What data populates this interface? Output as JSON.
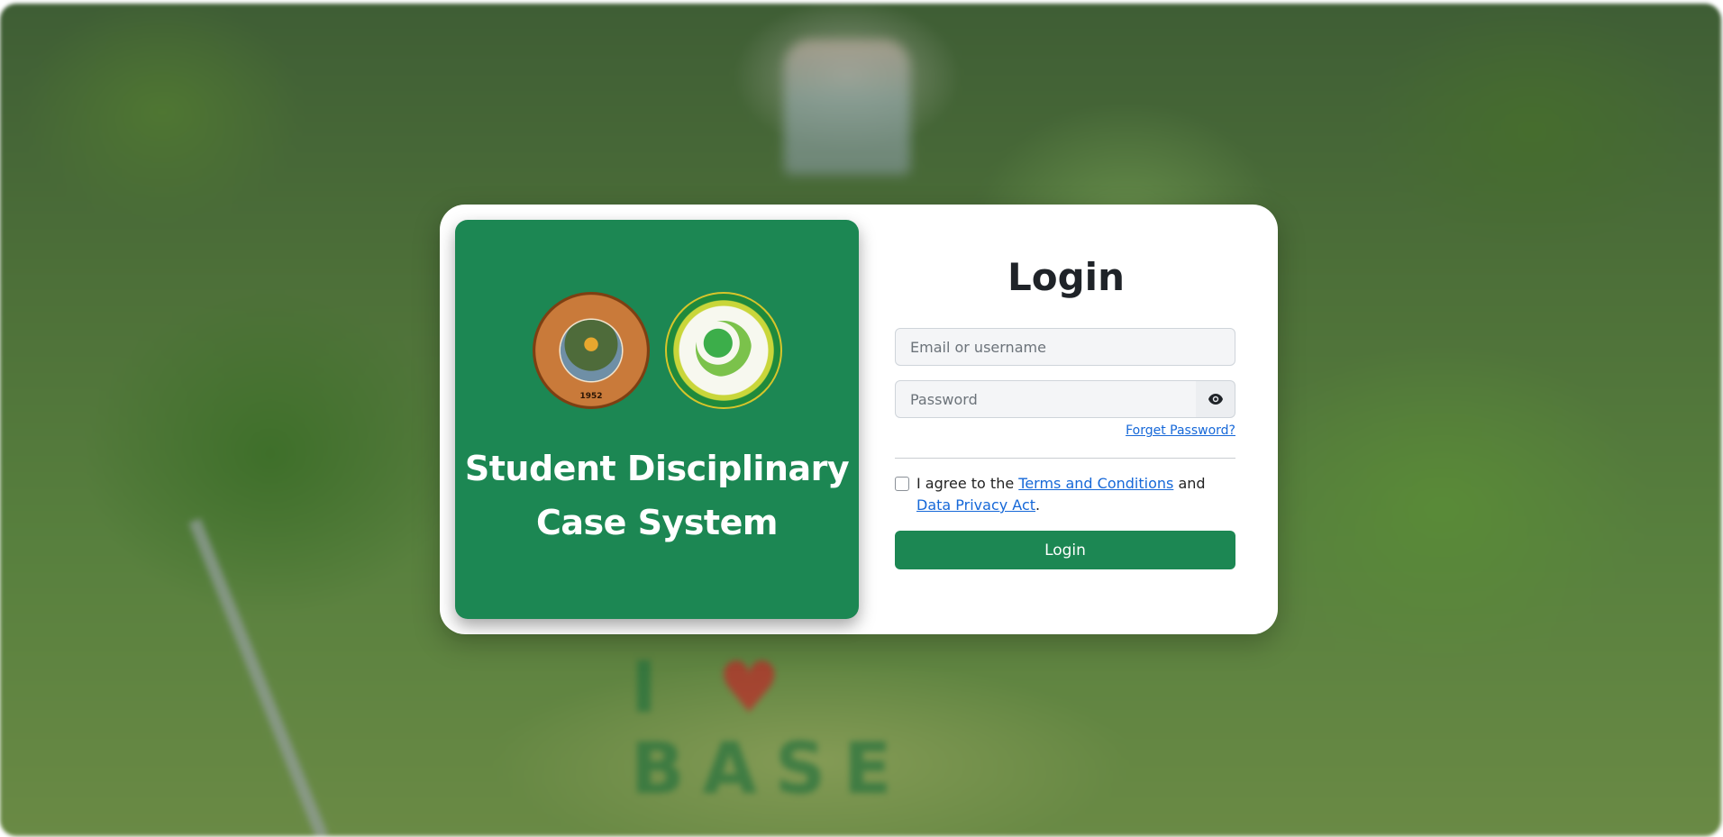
{
  "background": {
    "sign_letters": [
      "I",
      "B",
      "A",
      "S",
      "E"
    ],
    "sign_heart": "♥"
  },
  "brand": {
    "title_line1": "Student Disciplinary",
    "title_line2": "Case System",
    "logo_left_year": "1952",
    "accent_color": "#1c8753"
  },
  "login": {
    "heading": "Login",
    "email_placeholder": "Email or username",
    "email_value": "",
    "password_placeholder": "Password",
    "password_value": "",
    "toggle_icon": "eye-icon",
    "forget_password": "Forget Password?",
    "agree_prefix": "I agree to the",
    "terms_link": "Terms and Conditions",
    "agree_and": "and",
    "privacy_link": "Data Privacy Act",
    "agree_suffix": ".",
    "submit_label": "Login",
    "link_color": "#1668d8"
  }
}
